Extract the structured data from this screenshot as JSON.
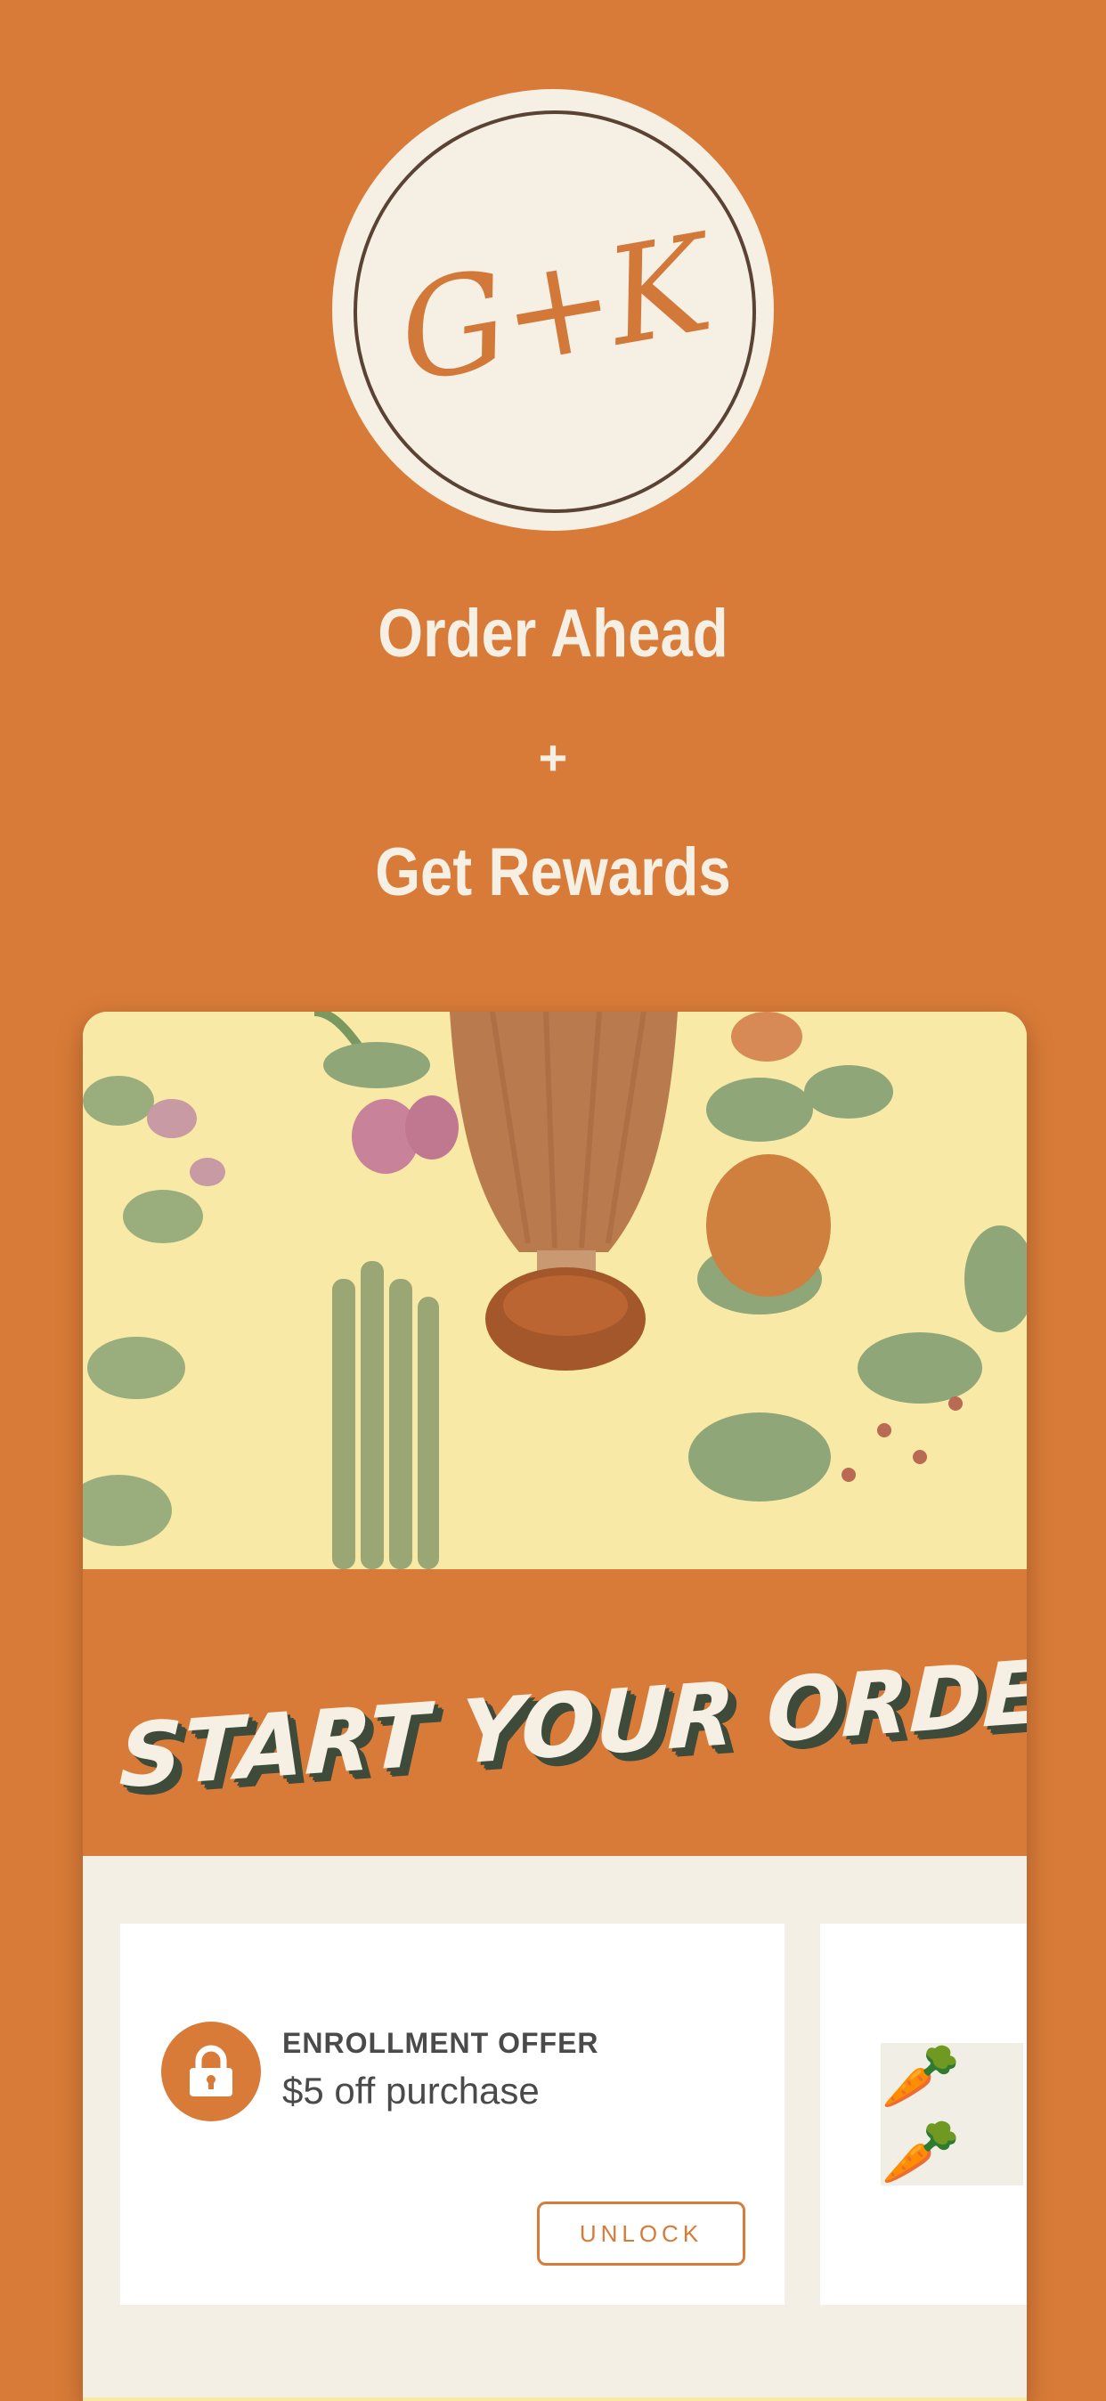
{
  "brand": {
    "logo_text": "G+K"
  },
  "tagline": {
    "line1": "Order Ahead",
    "plus": "+",
    "line2": "Get Rewards"
  },
  "banner": {
    "title": "START YOUR ORDER"
  },
  "offer": {
    "title": "ENROLLMENT OFFER",
    "subtitle": "$5 off purchase",
    "button": "UNLOCK",
    "icon": "lock-icon"
  },
  "offer2": {
    "icon": "carrot-icon",
    "emoji": "🥕🥕"
  },
  "colors": {
    "brand_orange": "#d97b38",
    "cream": "#f6efe3",
    "dark_green": "#3e4a3a"
  }
}
